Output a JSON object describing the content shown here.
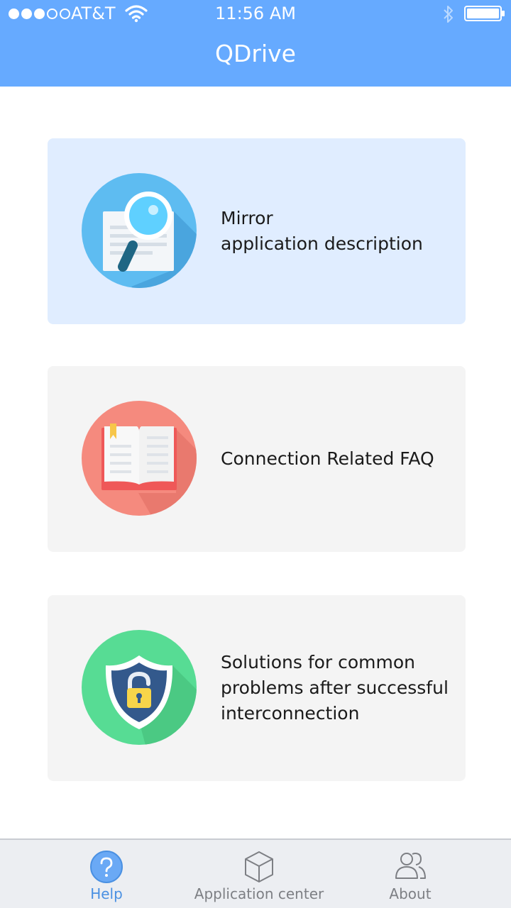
{
  "status_bar": {
    "carrier": "AT&T",
    "time": "11:56 AM",
    "signal_bars_filled": 3,
    "signal_bars_total": 5,
    "icons": [
      "wifi-icon",
      "bluetooth-icon",
      "battery-icon"
    ]
  },
  "header": {
    "title": "QDrive"
  },
  "cards": [
    {
      "label": "Mirror\napplication description",
      "icon": "magnifier-document-icon",
      "active": true
    },
    {
      "label": "Connection Related FAQ",
      "icon": "open-book-icon",
      "active": false
    },
    {
      "label": "Solutions for common\nproblems after successful\ninterconnection",
      "icon": "shield-lock-icon",
      "active": false
    }
  ],
  "tabbar": {
    "tabs": [
      {
        "label": "Help",
        "icon": "help-icon",
        "active": true
      },
      {
        "label": "Application center",
        "icon": "box-icon",
        "active": false
      },
      {
        "label": "About",
        "icon": "users-icon",
        "active": false
      }
    ]
  },
  "colors": {
    "header": "#66aaff",
    "active_card": "#e0edff",
    "card": "#f4f4f4",
    "accent": "#4a90e2",
    "tab_inactive": "#7d7f84"
  }
}
